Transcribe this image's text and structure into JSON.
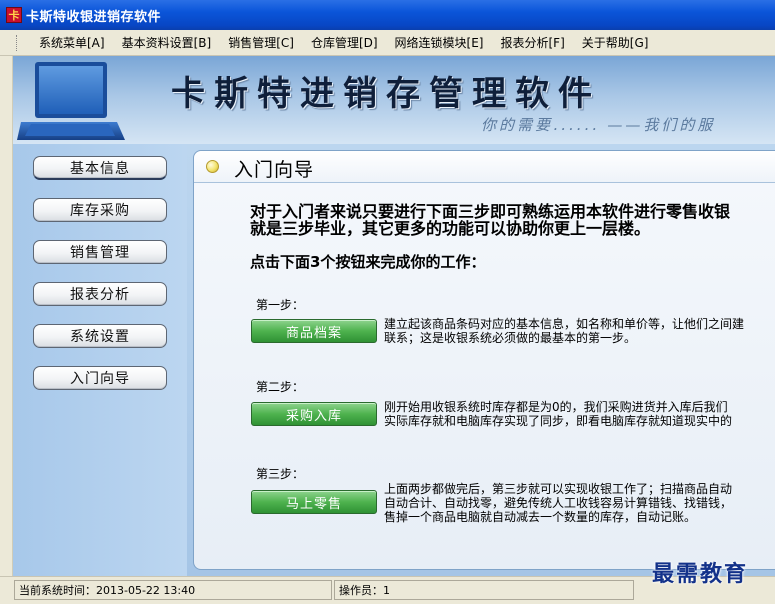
{
  "window": {
    "title": "卡斯特收银进销存软件",
    "icon_glyph": "卡"
  },
  "menu": [
    "系统菜单[A]",
    "基本资料设置[B]",
    "销售管理[C]",
    "仓库管理[D]",
    "网络连锁模块[E]",
    "报表分析[F]",
    "关于帮助[G]"
  ],
  "banner": {
    "title": "卡斯特进销存管理软件",
    "slogan": "你的需要......   ——我们的服"
  },
  "nav": [
    "基本信息",
    "库存采购",
    "销售管理",
    "报表分析",
    "系统设置",
    "入门向导"
  ],
  "panel": {
    "title": "入门向导",
    "intro_line1": "对于入门者来说只要进行下面三步即可熟练运用本软件进行零售收银",
    "intro_line2": "就是三步毕业，其它更多的功能可以协助你更上一层楼。",
    "instruction": "点击下面3个按钮来完成你的工作：",
    "steps": [
      {
        "label": "第一步：",
        "button": "商品档案",
        "desc1": "建立起该商品条码对应的基本信息，如名称和单价等，让他们之间建",
        "desc2": "联系；这是收银系统必须做的最基本的第一步。",
        "desc3": ""
      },
      {
        "label": "第二步：",
        "button": "采购入库",
        "desc1": "刚开始用收银系统时库存都是为0的，我们采购进货并入库后我们",
        "desc2": "实际库存就和电脑库存实现了同步，即看电脑库存就知道现实中的",
        "desc3": ""
      },
      {
        "label": "第三步：",
        "button": "马上零售",
        "desc1": "上面两步都做完后，第三步就可以实现收银工作了；扫描商品自动",
        "desc2": "自动合计、自动找零，避免传统人工收钱容易计算错钱、找错钱，",
        "desc3": "售掉一个商品电脑就自动减去一个数量的库存，自动记账。"
      }
    ]
  },
  "status": {
    "time": "当前系统时间：2013-05-22 13:40",
    "operator": "操作员：1"
  },
  "watermark": "最需教育",
  "colors": {
    "titlebar": "#0a55d9",
    "step_button": "#4eb24e",
    "nav_bg": "#bcd6f0"
  }
}
